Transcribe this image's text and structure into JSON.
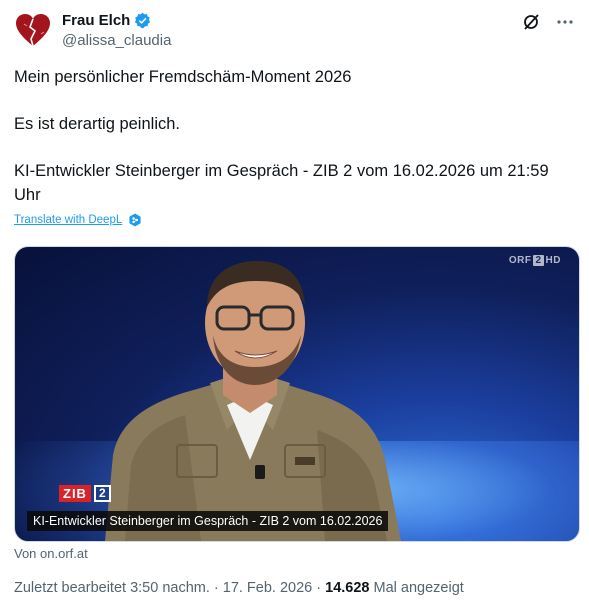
{
  "author": {
    "name": "Frau Elch",
    "handle": "@alissa_claudia"
  },
  "tweet": {
    "line1": "Mein persönlicher Fremdschäm-Moment 2026",
    "line2": "Es ist derartig peinlich.",
    "line3": "KI-Entwickler Steinberger im Gespräch - ZIB 2 vom 16.02.2026 um 21:59 Uhr"
  },
  "translate_label": "Translate with DeepL",
  "media": {
    "channel_logo": "ORF",
    "channel_num": "2",
    "channel_hd": "HD",
    "show_logo": "ZIB",
    "show_num": "2",
    "caption": "KI-Entwickler Steinberger im Gespräch - ZIB 2 vom 16.02.2026"
  },
  "source": "Von on.orf.at",
  "meta": {
    "edited": "Zuletzt bearbeitet 3:50 nachm. · 17. Feb. 2026 · ",
    "views_count": "14.628",
    "views_label": " Mal angezeigt"
  },
  "colors": {
    "link": "#1d9bf0",
    "secondary_text": "#536471",
    "zib_red": "#d8232a"
  },
  "icons": [
    "broken-heart-avatar",
    "verified-badge-icon",
    "grok-icon",
    "more-icon",
    "deepl-icon"
  ]
}
